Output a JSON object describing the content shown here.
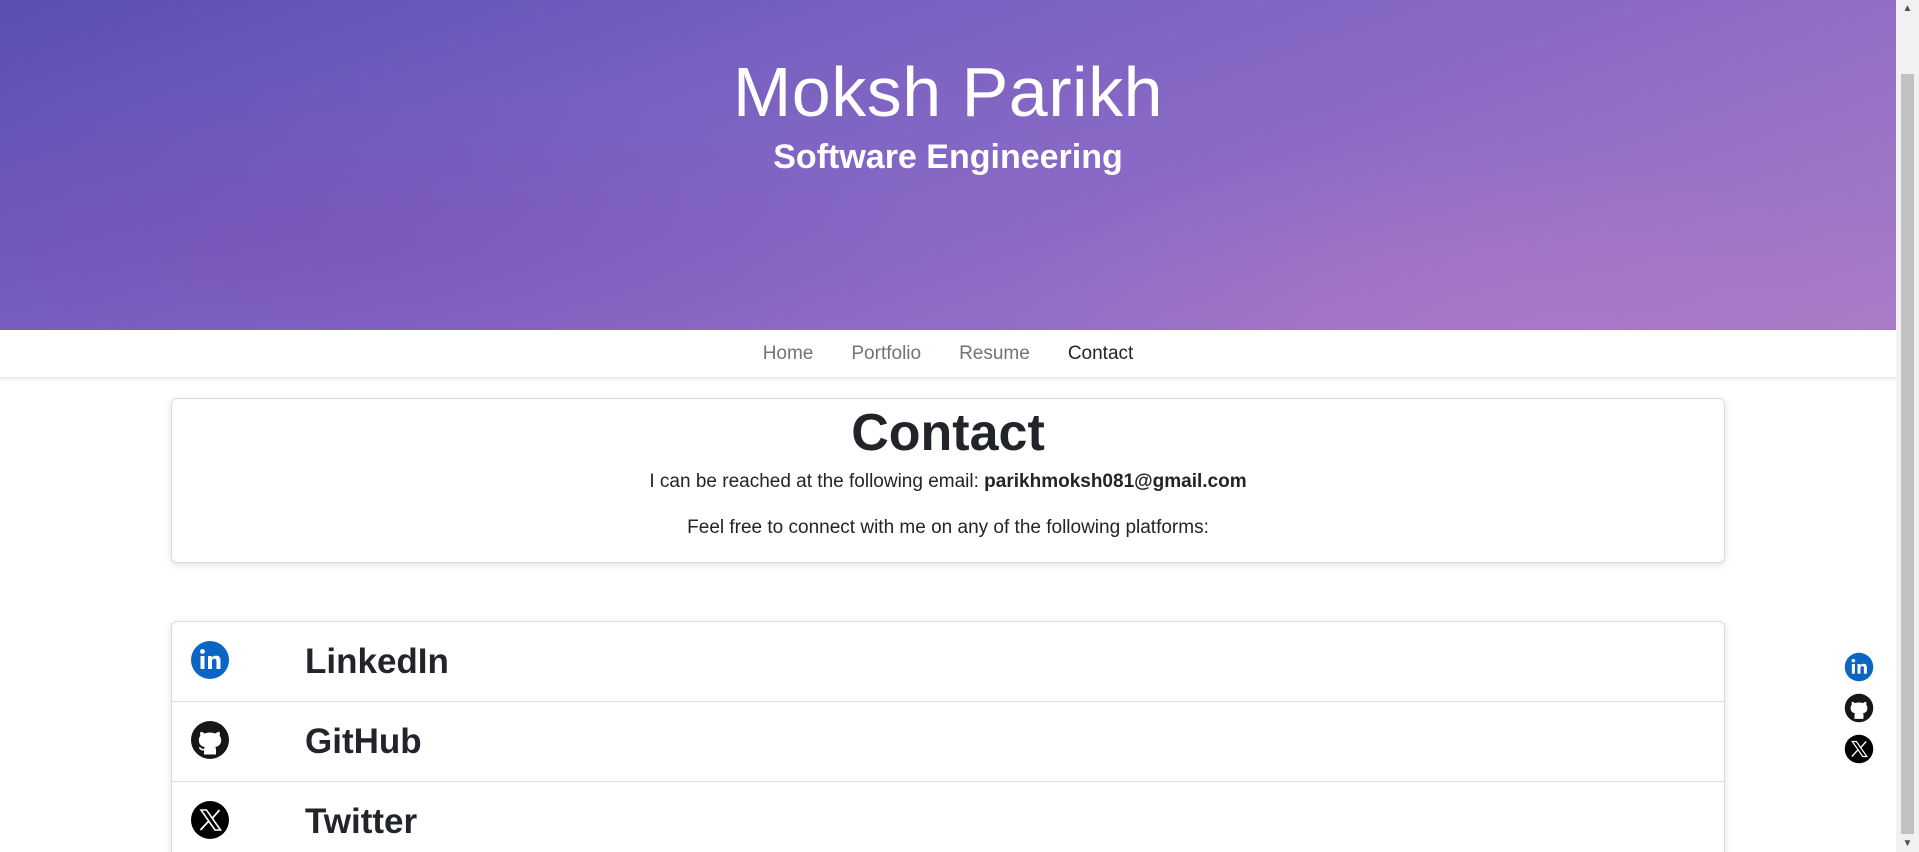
{
  "header": {
    "title": "Moksh Parikh",
    "subtitle": "Software Engineering"
  },
  "nav": {
    "items": [
      {
        "label": "Home",
        "active": false
      },
      {
        "label": "Portfolio",
        "active": false
      },
      {
        "label": "Resume",
        "active": false
      },
      {
        "label": "Contact",
        "active": true
      }
    ]
  },
  "contact": {
    "title": "Contact",
    "email_prefix": "I can be reached at the following email: ",
    "email": "parikhmoksh081@gmail.com",
    "platforms_text": "Feel free to connect with me on any of the following platforms:"
  },
  "links": [
    {
      "label": "LinkedIn",
      "icon": "linkedin-icon"
    },
    {
      "label": "GitHub",
      "icon": "github-icon"
    },
    {
      "label": "Twitter",
      "icon": "x-twitter-icon"
    }
  ],
  "floating_icons": [
    "linkedin-icon",
    "github-icon",
    "x-twitter-icon"
  ],
  "colors": {
    "linkedin_blue": "#0a66c2",
    "header_gradient_start": "#5a4fb2",
    "header_gradient_end": "#a77cc6",
    "text_dark": "#212529",
    "nav_muted": "#6c757d"
  }
}
